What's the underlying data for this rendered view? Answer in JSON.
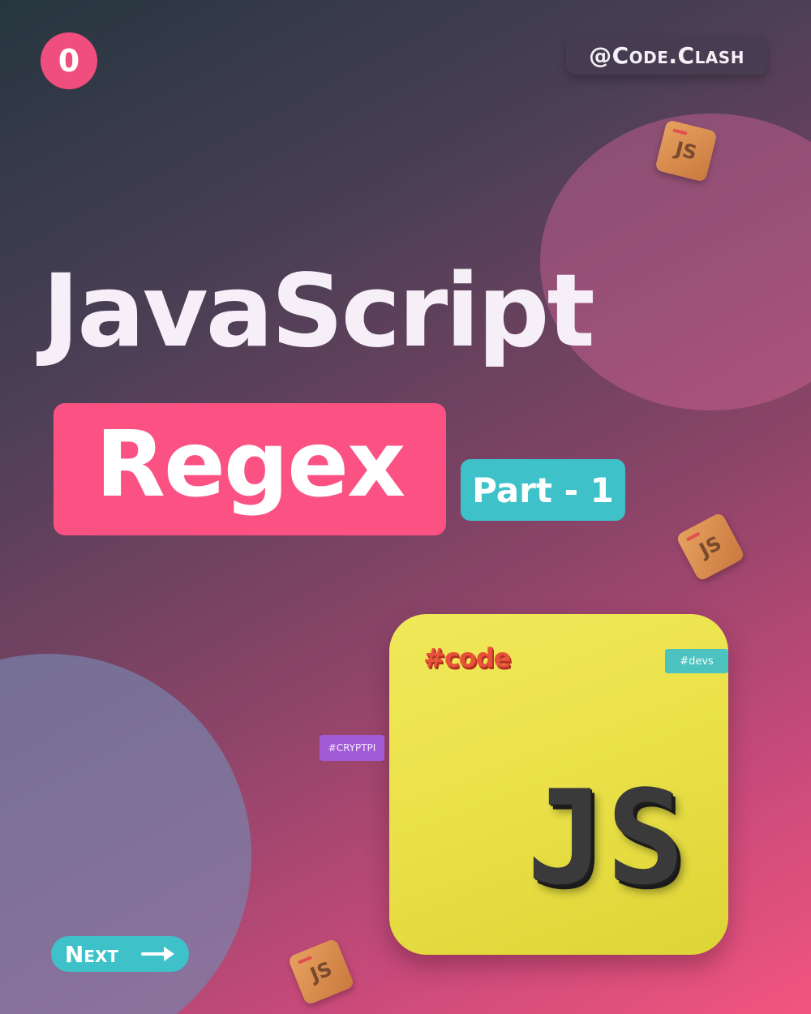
{
  "page_number": "0",
  "handle": "@Code.Clash",
  "title": "JavaScript",
  "subtitle": "Regex",
  "part": "Part - 1",
  "tags": {
    "code": "#code",
    "devs": "#devs",
    "crypt": "#CRYPTPI"
  },
  "cube_label": "JS",
  "js_logo": "JS",
  "nav": {
    "next_label": "Next"
  },
  "colors": {
    "accent_pink": "#fb5283",
    "accent_teal": "#3fc1c9",
    "js_yellow": "#ebe24a"
  }
}
